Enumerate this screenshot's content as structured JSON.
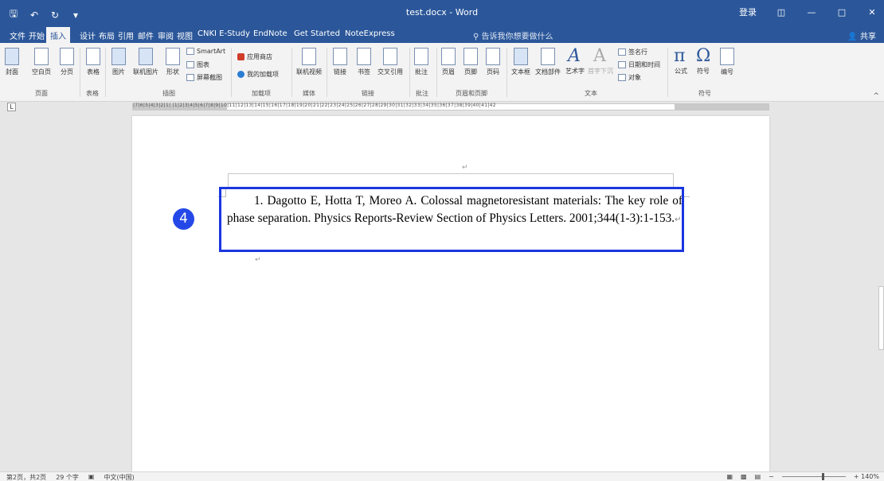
{
  "app": {
    "title": "test.docx - Word",
    "signin": "登录",
    "colors": {
      "brand": "#2b579a",
      "highlight": "#1a36e0",
      "badge": "#2448e8"
    }
  },
  "qat": {
    "save_icon": "save-icon",
    "undo_icon": "undo-icon",
    "redo_icon": "redo-icon",
    "more_icon": "customize-icon"
  },
  "tabs": [
    "文件",
    "开始",
    "插入",
    "设计",
    "布局",
    "引用",
    "邮件",
    "审阅",
    "视图",
    "CNKI E-Study",
    "EndNote",
    "Get Started",
    "NoteExpress"
  ],
  "active_tab": "插入",
  "tell_me": "告诉我你想要做什么",
  "share": "共享",
  "ribbon": {
    "pages": {
      "cover": "封面",
      "blank": "空白页",
      "break": "分页",
      "label": "页面"
    },
    "tables": {
      "table": "表格",
      "label": "表格"
    },
    "illustrations": {
      "picture": "图片",
      "online": "联机图片",
      "shapes": "形状",
      "smartart": "SmartArt",
      "chart": "图表",
      "screenshot": "屏幕截图",
      "label": "插图"
    },
    "addins": {
      "store": "应用商店",
      "my": "我的加载项",
      "label": "加载项"
    },
    "media": {
      "video": "联机视频",
      "label": "媒体"
    },
    "links": {
      "link": "链接",
      "bookmark": "书签",
      "crossref": "交叉引用",
      "label": "链接"
    },
    "comments": {
      "comment": "批注",
      "label": "批注"
    },
    "headerfooter": {
      "header": "页眉",
      "footer": "页脚",
      "pagenum": "页码",
      "label": "页眉和页脚"
    },
    "text": {
      "textbox": "文本框",
      "parts": "文档部件",
      "wordart": "艺术字",
      "dropcap": "首字下沉",
      "signature": "签名行",
      "datetime": "日期和时间",
      "object": "对象",
      "label": "文本"
    },
    "symbols": {
      "equation": "公式",
      "symbol": "符号",
      "number": "编号",
      "label": "符号"
    }
  },
  "ruler": {
    "numbers": "|7|6|5|4|3|2|1| |1|2|3|4|5|6|7|8|9|10|11|12|13|14|15|16|17|18|19|20|21|22|23|24|25|26|27|28|29|30|31|32|33|34|35|36|37|38|39|40|41|42"
  },
  "document": {
    "reference": "1.  Dagotto E, Hotta T, Moreo A. Colossal magnetoresistant materials: The key role of phase separation. Physics Reports-Review Section of Physics Letters. 2001;344(1-3):1-153.",
    "paragraph_mark": "↵",
    "badge": "4"
  },
  "status": {
    "page": "第2页，共2页",
    "words": "29 个字",
    "language": "中文(中国)",
    "zoom": "+ 140%"
  }
}
